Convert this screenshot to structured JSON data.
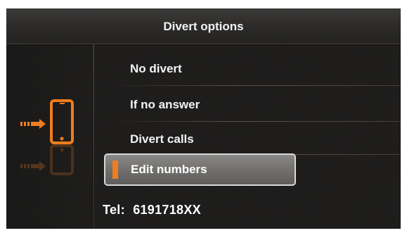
{
  "header": {
    "title": "Divert options"
  },
  "menu": {
    "items": [
      {
        "label": "No divert"
      },
      {
        "label": "If no answer"
      },
      {
        "label": "Divert calls"
      },
      {
        "label": "Edit numbers",
        "selected": true
      }
    ]
  },
  "footer": {
    "tel_label": "Tel:",
    "tel_number": "6191718XX"
  },
  "icons": {
    "side": "phone-divert-icon"
  },
  "colors": {
    "accent": "#f07d1e",
    "background": "#1e1d1c",
    "selected_bg": "#7a7977"
  }
}
